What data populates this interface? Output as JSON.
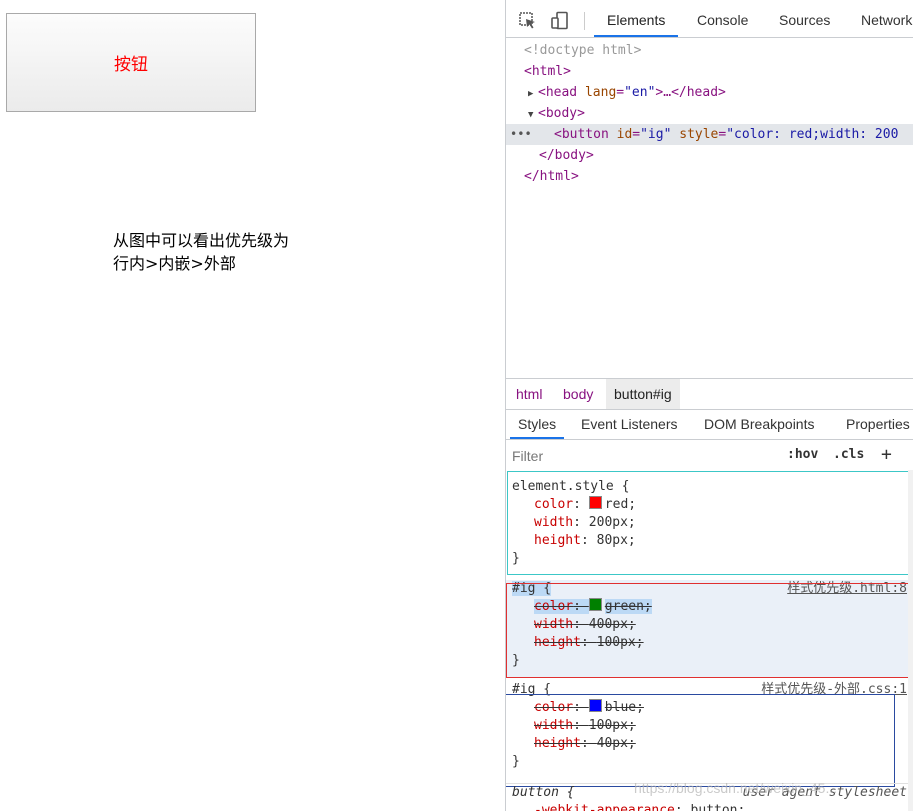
{
  "page": {
    "button_label": "按钮",
    "note_line1": "从图中可以看出优先级为",
    "note_line2": "行内>内嵌>外部"
  },
  "devtools": {
    "tabs": [
      "Elements",
      "Console",
      "Sources",
      "Network"
    ],
    "active_tab": "Elements",
    "dom": {
      "doctype": "<!doctype html>",
      "html_open": "<html>",
      "head_open": "<head",
      "head_attr": "lang",
      "head_val": "\"en\"",
      "head_rest": ">…</head>",
      "body_open": "<body>",
      "button_open": "<button",
      "button_attr1": "id",
      "button_val1": "\"ig\"",
      "button_attr2": "style",
      "button_val2": "\"color: red;width: 200",
      "body_close": "</body>",
      "html_close": "</html>"
    },
    "breadcrumbs": [
      "html",
      "body",
      "button#ig"
    ],
    "style_tabs": [
      "Styles",
      "Event Listeners",
      "DOM Breakpoints",
      "Properties"
    ],
    "filter_placeholder": "Filter",
    "hov": ":hov",
    "cls": ".cls",
    "plus": "+",
    "rules": [
      {
        "selector": "element.style {",
        "source": "",
        "props": [
          {
            "name": "color",
            "value": "red;",
            "swatch": "#ff0000"
          },
          {
            "name": "width",
            "value": "200px;"
          },
          {
            "name": "height",
            "value": "80px;"
          }
        ]
      },
      {
        "selector": "#ig {",
        "source": "样式优先级.html:8",
        "props": [
          {
            "name": "color",
            "value": "green;",
            "swatch": "#008000"
          },
          {
            "name": "width",
            "value": "400px;"
          },
          {
            "name": "height",
            "value": "100px;"
          }
        ]
      },
      {
        "selector": "#ig {",
        "source": "样式优先级-外部.css:1",
        "props": [
          {
            "name": "color",
            "value": "blue;",
            "swatch": "#0000ff"
          },
          {
            "name": "width",
            "value": "100px;"
          },
          {
            "name": "height",
            "value": "40px;"
          }
        ]
      },
      {
        "selector": "button {",
        "source": "user agent stylesheet",
        "props": [
          {
            "name": "-webkit-appearance",
            "value": "button;"
          }
        ]
      }
    ],
    "close_brace": "}",
    "watermark": "https://blog.csdn.net/weixin_45..."
  },
  "colors": {
    "accent": "#1a73e8",
    "box_inline": "#3cc7c7",
    "box_embedded": "#e03030",
    "box_external": "#2a4aa0"
  }
}
